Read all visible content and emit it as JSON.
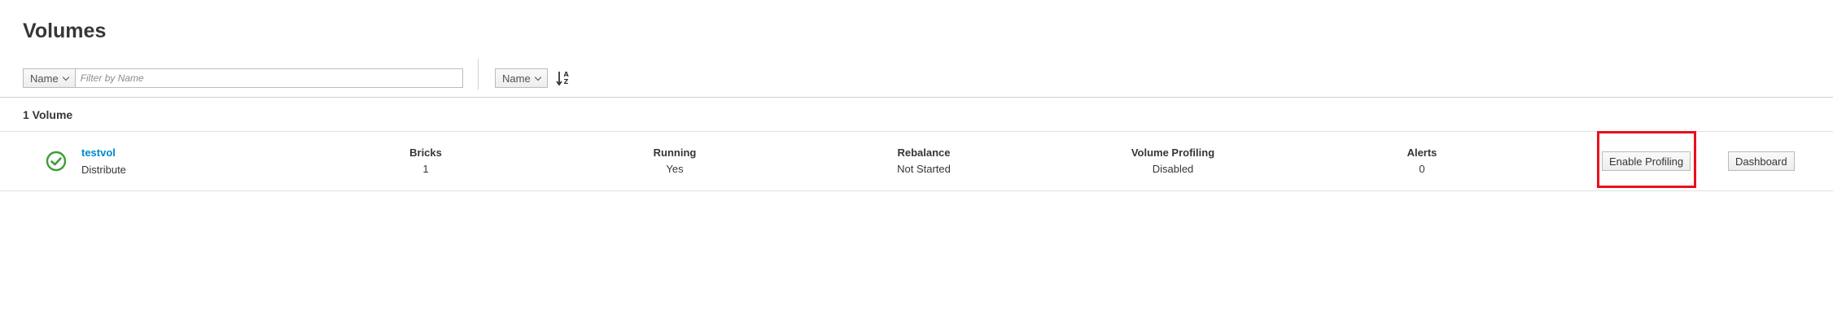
{
  "page": {
    "title": "Volumes"
  },
  "filter": {
    "field_label": "Name",
    "placeholder": "Filter by Name",
    "value": ""
  },
  "sort": {
    "field_label": "Name",
    "direction_icon": "sort-alpha-asc-icon"
  },
  "results": {
    "count_label": "1 Volume"
  },
  "volumes": [
    {
      "name": "testvol",
      "type": "Distribute",
      "status_icon": "check-circle-icon",
      "status_color": "#3f9c35",
      "stats": [
        {
          "label": "Bricks",
          "value": "1"
        },
        {
          "label": "Running",
          "value": "Yes"
        },
        {
          "label": "Rebalance",
          "value": "Not Started"
        },
        {
          "label": "Volume Profiling",
          "value": "Disabled"
        },
        {
          "label": "Alerts",
          "value": "0"
        }
      ],
      "actions": {
        "profiling_label": "Enable Profiling",
        "dashboard_label": "Dashboard"
      }
    }
  ],
  "colors": {
    "link": "#0088ce",
    "highlight": "#e8101c"
  }
}
